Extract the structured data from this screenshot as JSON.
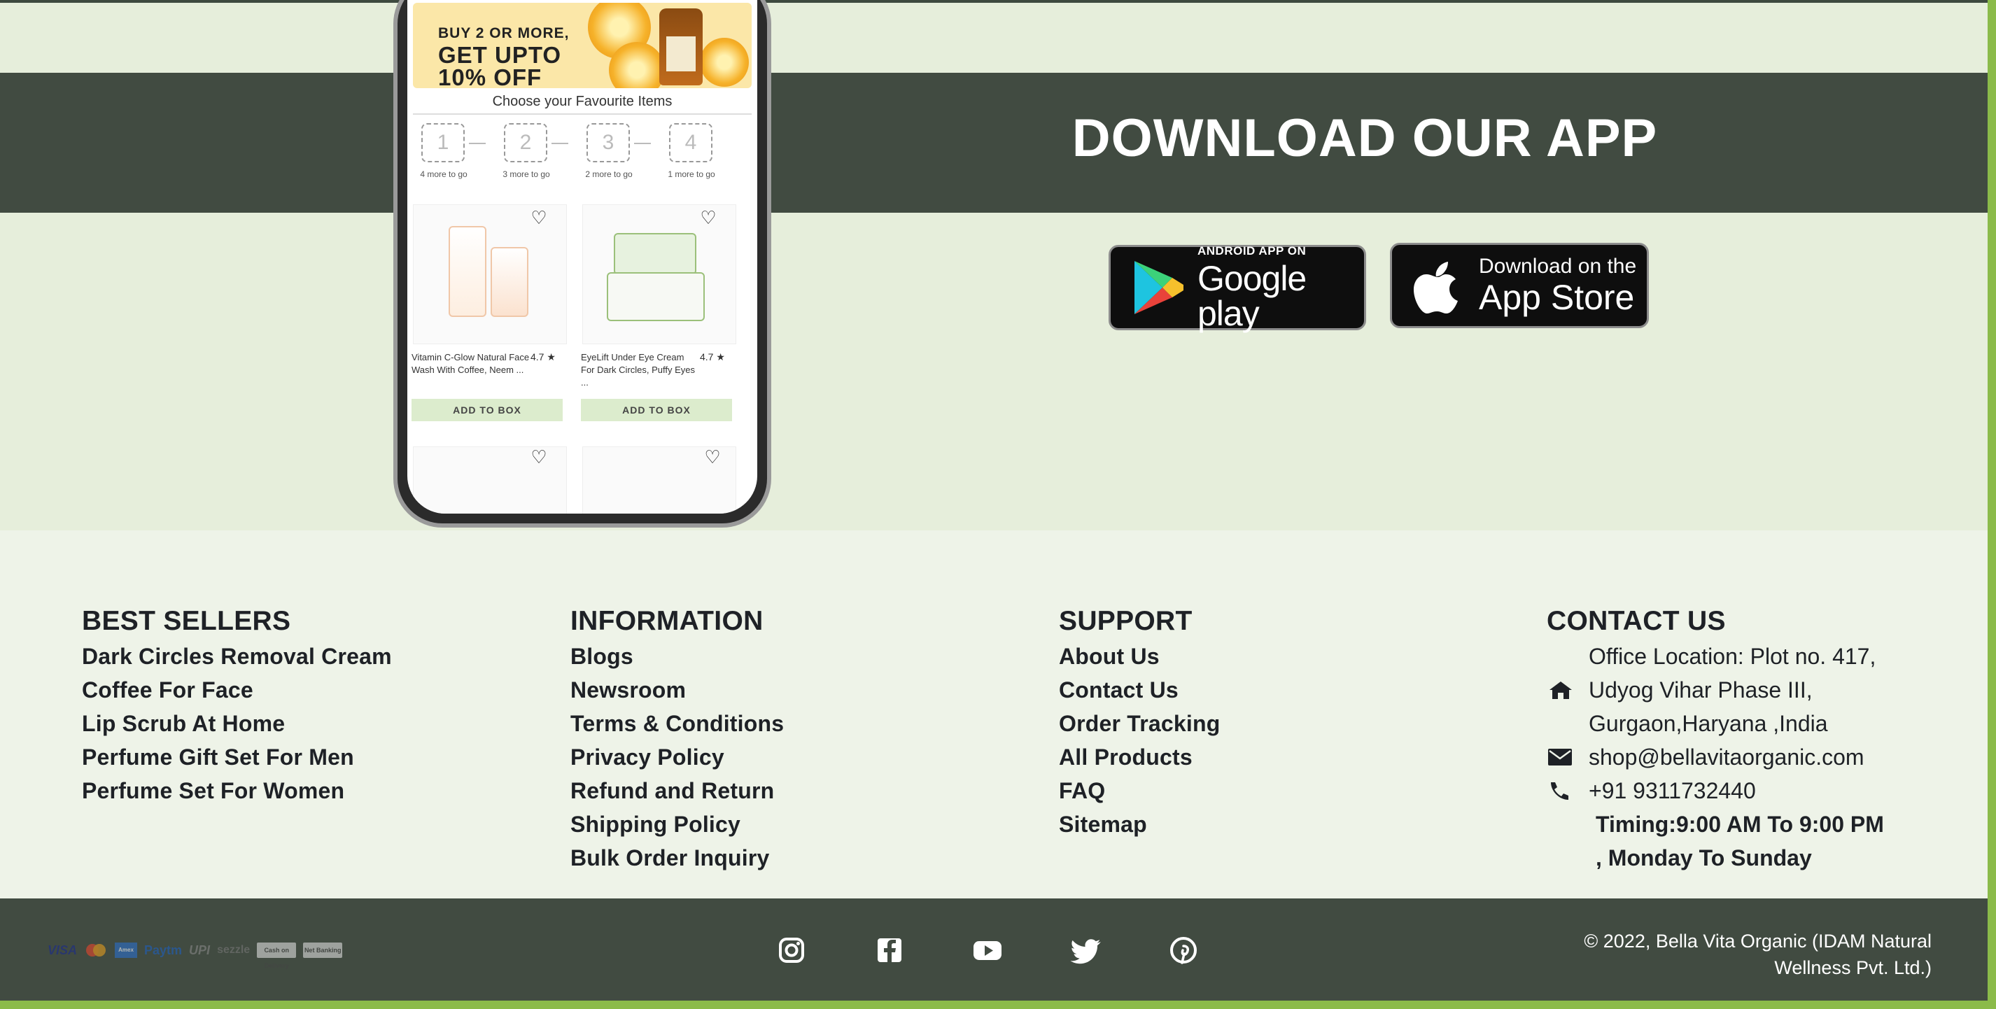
{
  "app_section": {
    "title": "DOWNLOAD OUR APP",
    "google_play": {
      "small": "ANDROID APP ON",
      "big": "Google play"
    },
    "app_store": {
      "small": "Download on the",
      "big": "App Store"
    }
  },
  "phone": {
    "promo_line1": "BUY 2 OR MORE,",
    "promo_line2": "GET UPTO",
    "promo_line3": "10% OFF",
    "choose_label": "Choose your Favourite Items",
    "steps": [
      {
        "num": "1",
        "label": "4 more to go"
      },
      {
        "num": "2",
        "label": "3 more to go"
      },
      {
        "num": "3",
        "label": "2 more to go"
      },
      {
        "num": "4",
        "label": "1 more to go"
      }
    ],
    "products": [
      {
        "name": "Vitamin C-Glow Natural Face Wash With Coffee, Neem ...",
        "rating": "4.7 ★",
        "button": "ADD TO BOX"
      },
      {
        "name": "EyeLift Under Eye Cream For Dark Circles, Puffy Eyes ...",
        "rating": "4.7 ★",
        "button": "ADD TO BOX"
      }
    ]
  },
  "footer": {
    "best_sellers": {
      "heading": "BEST SELLERS",
      "links": [
        "Dark Circles Removal Cream",
        "Coffee For Face",
        "Lip Scrub At Home",
        "Perfume Gift Set For Men",
        "Perfume Set For Women"
      ]
    },
    "information": {
      "heading": "INFORMATION",
      "links": [
        "Blogs",
        "Newsroom",
        "Terms & Conditions",
        "Privacy Policy",
        "Refund and Return",
        "Shipping Policy",
        "Bulk Order Inquiry"
      ]
    },
    "support": {
      "heading": "SUPPORT",
      "links": [
        "About Us",
        "Contact Us",
        "Order Tracking",
        "All Products",
        "FAQ",
        "Sitemap"
      ]
    },
    "contact": {
      "heading": "CONTACT US",
      "address_lines": [
        "Office Location: Plot no. 417,",
        "Udyog Vihar Phase III,",
        "Gurgaon,Haryana ,India"
      ],
      "email": "shop@bellavitaorganic.com",
      "phone": "+91 9311732440",
      "timing_line1": "Timing:9:00 AM To 9:00 PM",
      "timing_line2": ", Monday To Sunday",
      "icons": [
        "home-icon",
        "mail-icon",
        "phone-icon"
      ]
    }
  },
  "bottom_bar": {
    "payment_methods": [
      "VISA",
      "Mastercard",
      "Amex",
      "Paytm",
      "UPI",
      "sezzle",
      "Cash on Delivery",
      "Net Banking"
    ],
    "social_icons": [
      "instagram-icon",
      "facebook-icon",
      "youtube-icon",
      "twitter-icon",
      "pinterest-icon"
    ],
    "copyright_line1": "© 2022, Bella Vita Organic (IDAM Natural",
    "copyright_line2": "Wellness Pvt. Ltd.)"
  },
  "colors": {
    "dark_band": "#414b41",
    "app_bg": "#e6eedb",
    "footer_bg": "#eef3e8",
    "accent_green": "#8bbb4a",
    "text_dark": "#1e2126"
  }
}
